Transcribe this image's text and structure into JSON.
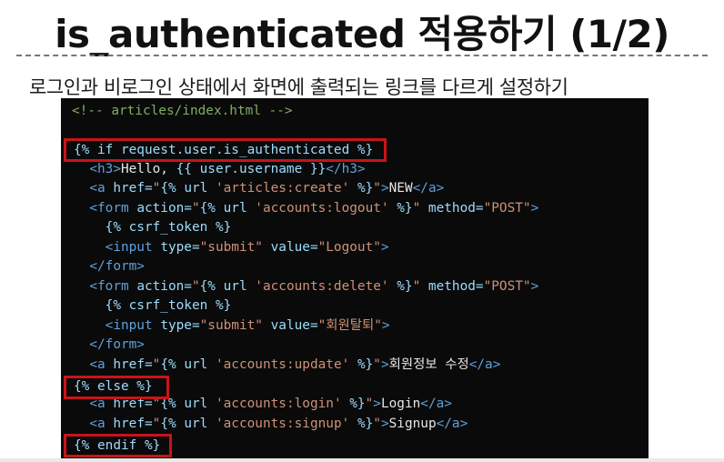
{
  "slide": {
    "title": "is_authenticated 적용하기 (1/2)",
    "subtitle": "로그인과 비로그인 상태에서 화면에 출력되는 링크를 다르게 설정하기"
  },
  "code": {
    "lines": [
      [
        {
          "t": "<!-- articles/index.html -->",
          "c": "comment"
        }
      ],
      [],
      [
        {
          "t": "{% if request.user.is_authenticated %}",
          "c": "tmpl"
        }
      ],
      [
        {
          "t": "  "
        },
        {
          "t": "<h3>",
          "c": "tag"
        },
        {
          "t": "Hello, ",
          "c": "text"
        },
        {
          "t": "{{ user.username }}",
          "c": "tmpl"
        },
        {
          "t": "</h3>",
          "c": "tag"
        }
      ],
      [
        {
          "t": "  "
        },
        {
          "t": "<a ",
          "c": "tag"
        },
        {
          "t": "href=",
          "c": "attr"
        },
        {
          "t": "\"",
          "c": "str"
        },
        {
          "t": "{% url ",
          "c": "tmpl"
        },
        {
          "t": "'articles:create'",
          "c": "str"
        },
        {
          "t": " %}",
          "c": "tmpl"
        },
        {
          "t": "\"",
          "c": "str"
        },
        {
          "t": ">",
          "c": "tag"
        },
        {
          "t": "NEW",
          "c": "text"
        },
        {
          "t": "</a>",
          "c": "tag"
        }
      ],
      [
        {
          "t": "  "
        },
        {
          "t": "<form ",
          "c": "tag"
        },
        {
          "t": "action=",
          "c": "attr"
        },
        {
          "t": "\"",
          "c": "str"
        },
        {
          "t": "{% url ",
          "c": "tmpl"
        },
        {
          "t": "'accounts:logout'",
          "c": "str"
        },
        {
          "t": " %}",
          "c": "tmpl"
        },
        {
          "t": "\" ",
          "c": "str"
        },
        {
          "t": "method=",
          "c": "attr"
        },
        {
          "t": "\"POST\"",
          "c": "str"
        },
        {
          "t": ">",
          "c": "tag"
        }
      ],
      [
        {
          "t": "    "
        },
        {
          "t": "{% csrf_token %}",
          "c": "tmpl"
        }
      ],
      [
        {
          "t": "    "
        },
        {
          "t": "<input ",
          "c": "tag"
        },
        {
          "t": "type=",
          "c": "attr"
        },
        {
          "t": "\"submit\" ",
          "c": "str"
        },
        {
          "t": "value=",
          "c": "attr"
        },
        {
          "t": "\"Logout\"",
          "c": "str"
        },
        {
          "t": ">",
          "c": "tag"
        }
      ],
      [
        {
          "t": "  "
        },
        {
          "t": "</form>",
          "c": "tag"
        }
      ],
      [
        {
          "t": "  "
        },
        {
          "t": "<form ",
          "c": "tag"
        },
        {
          "t": "action=",
          "c": "attr"
        },
        {
          "t": "\"",
          "c": "str"
        },
        {
          "t": "{% url ",
          "c": "tmpl"
        },
        {
          "t": "'accounts:delete'",
          "c": "str"
        },
        {
          "t": " %}",
          "c": "tmpl"
        },
        {
          "t": "\" ",
          "c": "str"
        },
        {
          "t": "method=",
          "c": "attr"
        },
        {
          "t": "\"POST\"",
          "c": "str"
        },
        {
          "t": ">",
          "c": "tag"
        }
      ],
      [
        {
          "t": "    "
        },
        {
          "t": "{% csrf_token %}",
          "c": "tmpl"
        }
      ],
      [
        {
          "t": "    "
        },
        {
          "t": "<input ",
          "c": "tag"
        },
        {
          "t": "type=",
          "c": "attr"
        },
        {
          "t": "\"submit\" ",
          "c": "str"
        },
        {
          "t": "value=",
          "c": "attr"
        },
        {
          "t": "\"회원탈퇴\"",
          "c": "str"
        },
        {
          "t": ">",
          "c": "tag"
        }
      ],
      [
        {
          "t": "  "
        },
        {
          "t": "</form>",
          "c": "tag"
        }
      ],
      [
        {
          "t": "  "
        },
        {
          "t": "<a ",
          "c": "tag"
        },
        {
          "t": "href=",
          "c": "attr"
        },
        {
          "t": "\"",
          "c": "str"
        },
        {
          "t": "{% url ",
          "c": "tmpl"
        },
        {
          "t": "'accounts:update'",
          "c": "str"
        },
        {
          "t": " %}",
          "c": "tmpl"
        },
        {
          "t": "\"",
          "c": "str"
        },
        {
          "t": ">",
          "c": "tag"
        },
        {
          "t": "회원정보 수정",
          "c": "text"
        },
        {
          "t": "</a>",
          "c": "tag"
        }
      ],
      [
        {
          "t": "{% else %}",
          "c": "tmpl"
        }
      ],
      [
        {
          "t": "  "
        },
        {
          "t": "<a ",
          "c": "tag"
        },
        {
          "t": "href=",
          "c": "attr"
        },
        {
          "t": "\"",
          "c": "str"
        },
        {
          "t": "{% url ",
          "c": "tmpl"
        },
        {
          "t": "'accounts:login'",
          "c": "str"
        },
        {
          "t": " %}",
          "c": "tmpl"
        },
        {
          "t": "\"",
          "c": "str"
        },
        {
          "t": ">",
          "c": "tag"
        },
        {
          "t": "Login",
          "c": "text"
        },
        {
          "t": "</a>",
          "c": "tag"
        }
      ],
      [
        {
          "t": "  "
        },
        {
          "t": "<a ",
          "c": "tag"
        },
        {
          "t": "href=",
          "c": "attr"
        },
        {
          "t": "\"",
          "c": "str"
        },
        {
          "t": "{% url ",
          "c": "tmpl"
        },
        {
          "t": "'accounts:signup'",
          "c": "str"
        },
        {
          "t": " %}",
          "c": "tmpl"
        },
        {
          "t": "\"",
          "c": "str"
        },
        {
          "t": ">",
          "c": "tag"
        },
        {
          "t": "Signup",
          "c": "text"
        },
        {
          "t": "</a>",
          "c": "tag"
        }
      ],
      [
        {
          "t": "{% endif %}",
          "c": "tmpl"
        }
      ]
    ]
  },
  "colors": {
    "highlight_border": "#c81418",
    "code_background": "#0a0a0a"
  }
}
